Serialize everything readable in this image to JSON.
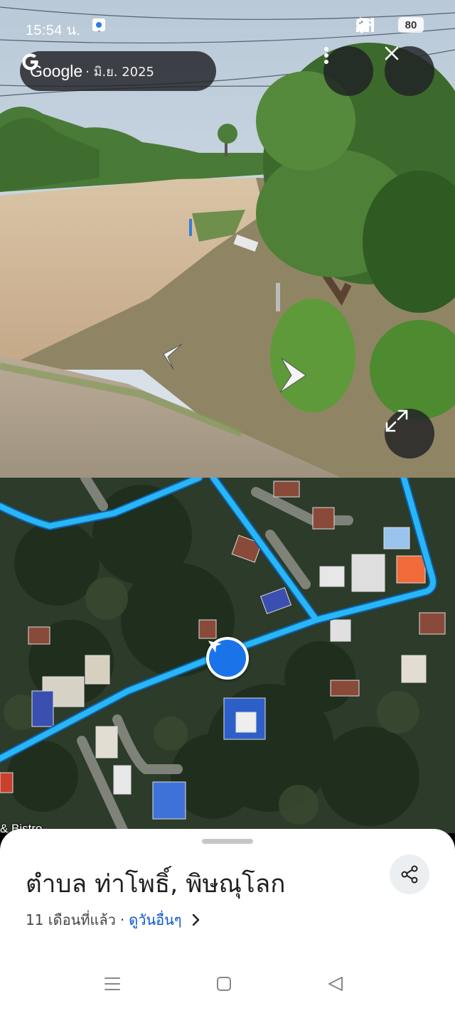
{
  "status_bar": {
    "time": "15:54 น.",
    "battery": "80",
    "left_icons": [
      "facebook-icon",
      "app-notification-icon"
    ],
    "right_icons": [
      "bluetooth-icon",
      "location-icon",
      "wifi-icon",
      "volte-icon",
      "signal-icon",
      "battery-icon"
    ]
  },
  "attribution": {
    "brand": "Google",
    "date": "· มิ.ย. 2025"
  },
  "streetview_controls": [
    "more-options-icon",
    "close-icon",
    "expand-icon",
    "arrow-left-icon",
    "arrow-right-icon"
  ],
  "map": {
    "poi_label": "& Bistro"
  },
  "place": {
    "title": "ตำบล ท่าโพธิ์, พิษณุโลก",
    "age": "11 เดือนที่แล้ว",
    "separator": "·",
    "see_other_dates": "ดูวันอื่นๆ"
  },
  "colors": {
    "route": "#29b6f6",
    "marker": "#1a73e8",
    "link": "#0b57d0"
  }
}
